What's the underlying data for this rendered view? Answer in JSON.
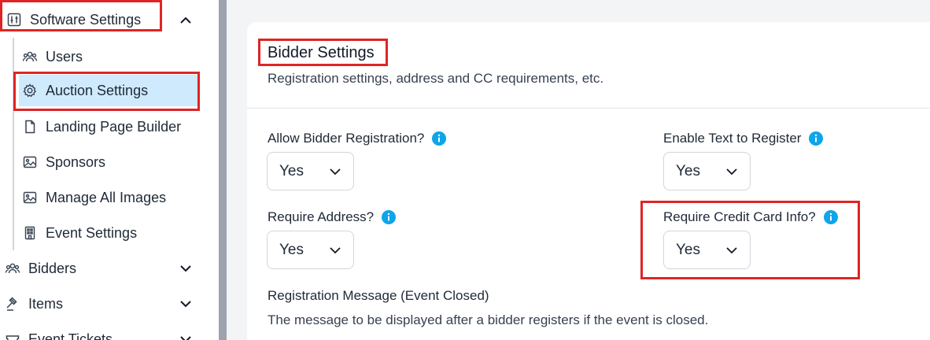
{
  "sidebar": {
    "software_settings": {
      "label": "Software Settings",
      "icon": "sliders-icon"
    },
    "sub_items": [
      {
        "label": "Users",
        "icon": "users-icon"
      },
      {
        "label": "Auction Settings",
        "icon": "gear-icon",
        "active": true
      },
      {
        "label": "Landing Page Builder",
        "icon": "file-icon"
      },
      {
        "label": "Sponsors",
        "icon": "image-icon"
      },
      {
        "label": "Manage All Images",
        "icon": "image-icon"
      },
      {
        "label": "Event Settings",
        "icon": "building-icon"
      }
    ],
    "groups": [
      {
        "label": "Bidders",
        "icon": "users-icon"
      },
      {
        "label": "Items",
        "icon": "gavel-icon"
      },
      {
        "label": "Event Tickets",
        "icon": "ticket-icon"
      }
    ]
  },
  "main": {
    "section": {
      "title": "Bidder Settings",
      "subtitle": "Registration settings, address and CC requirements, etc."
    },
    "fields": {
      "allow_bidder_registration": {
        "label": "Allow Bidder Registration?",
        "value": "Yes"
      },
      "enable_text_to_register": {
        "label": "Enable Text to Register",
        "value": "Yes"
      },
      "require_address": {
        "label": "Require Address?",
        "value": "Yes"
      },
      "require_credit_card_info": {
        "label": "Require Credit Card Info?",
        "value": "Yes"
      }
    },
    "registration_message": {
      "label": "Registration Message (Event Closed)",
      "description": "The message to be displayed after a bidder registers if the event is closed."
    }
  },
  "colors": {
    "highlight_red": "#e02424",
    "active_item_bg": "#cfeafd",
    "info_blue": "#0ea5e9",
    "divider_gray": "#9ca3af"
  }
}
